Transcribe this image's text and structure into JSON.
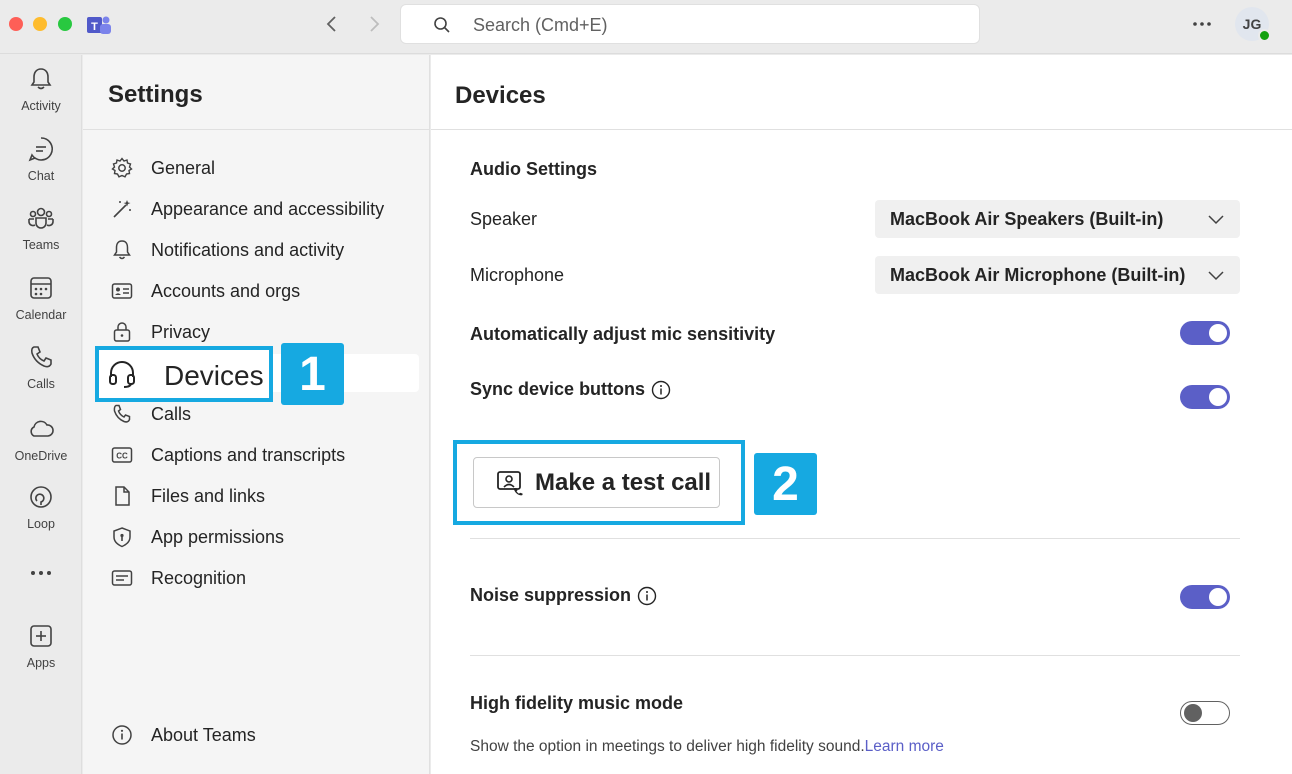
{
  "search": {
    "placeholder": "Search (Cmd+E)"
  },
  "account": {
    "initials": "JG"
  },
  "rail": [
    {
      "label": "Activity",
      "icon": "bell-icon"
    },
    {
      "label": "Chat",
      "icon": "chat-icon"
    },
    {
      "label": "Teams",
      "icon": "teams-icon"
    },
    {
      "label": "Calendar",
      "icon": "calendar-icon"
    },
    {
      "label": "Calls",
      "icon": "phone-icon"
    },
    {
      "label": "OneDrive",
      "icon": "cloud-icon"
    },
    {
      "label": "Loop",
      "icon": "loop-icon"
    },
    {
      "label": "Apps",
      "icon": "apps-icon"
    }
  ],
  "settings": {
    "title": "Settings",
    "items": [
      {
        "label": "General",
        "icon": "gear-icon"
      },
      {
        "label": "Appearance and accessibility",
        "icon": "wand-icon"
      },
      {
        "label": "Notifications and activity",
        "icon": "bell-icon"
      },
      {
        "label": "Accounts and orgs",
        "icon": "id-card-icon"
      },
      {
        "label": "Privacy",
        "icon": "lock-icon"
      },
      {
        "label": "Devices",
        "icon": "headset-icon",
        "selected": true
      },
      {
        "label": "Calls",
        "icon": "phone-icon"
      },
      {
        "label": "Captions and transcripts",
        "icon": "cc-icon"
      },
      {
        "label": "Files and links",
        "icon": "file-icon"
      },
      {
        "label": "App permissions",
        "icon": "shield-icon"
      },
      {
        "label": "Recognition",
        "icon": "recognition-icon"
      }
    ],
    "about": "About Teams"
  },
  "callouts": {
    "one": "1",
    "two": "2",
    "devices_label": "Devices"
  },
  "devices": {
    "title": "Devices",
    "audio_settings": "Audio Settings",
    "speaker_label": "Speaker",
    "speaker_value": "MacBook Air Speakers (Built-in)",
    "microphone_label": "Microphone",
    "microphone_value": "MacBook Air Microphone (Built-in)",
    "auto_mic_label": "Automatically adjust mic sensitivity",
    "auto_mic_on": true,
    "sync_buttons_label": "Sync device buttons",
    "sync_buttons_on": true,
    "test_call_label": "Make a test call",
    "noise_label": "Noise suppression",
    "noise_on": true,
    "hifi_label": "High fidelity music mode",
    "hifi_on": false,
    "hifi_hint": "Show the option in meetings to deliver high fidelity sound.",
    "learn_more": "Learn more"
  },
  "colors": {
    "accent": "#5b5fc7",
    "callout": "#16a9e1"
  }
}
